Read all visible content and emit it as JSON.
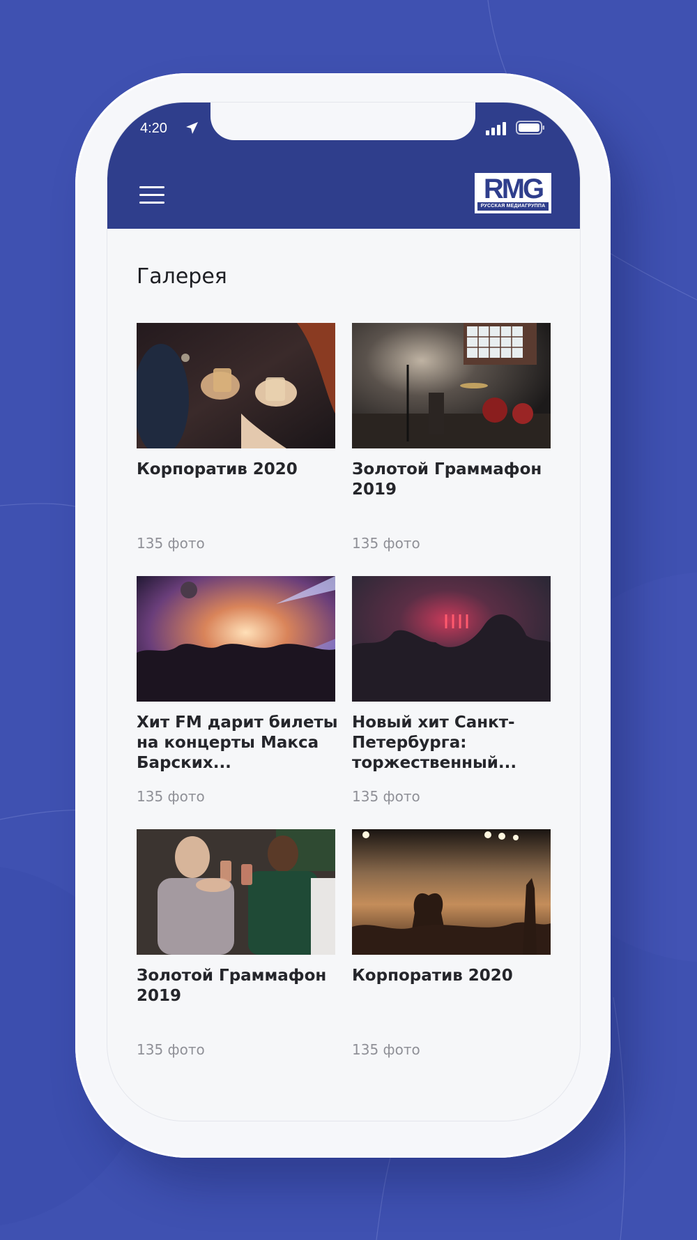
{
  "status_bar": {
    "time": "4:20"
  },
  "header": {
    "logo_letters": "RMG",
    "logo_caption": "РУССКАЯ МЕДИАГРУППА"
  },
  "page": {
    "title": "Галерея"
  },
  "gallery": [
    {
      "title": "Корпоратив 2020",
      "count": "135 фото"
    },
    {
      "title": "Золотой Граммафон 2019",
      "count": "135 фото"
    },
    {
      "title": "Хит FM дарит билеты на концерты Макса Барских...",
      "count": "135 фото"
    },
    {
      "title": "Новый хит Санкт-Петербурга: торжественный...",
      "count": "135 фото"
    },
    {
      "title": "Золотой Граммафон 2019",
      "count": "135 фото"
    },
    {
      "title": "Корпоратив 2020",
      "count": "135 фото"
    }
  ],
  "colors": {
    "background": "#3f51b1",
    "app_bar": "#2f3e8c",
    "screen": "#f6f7f9",
    "title_text": "#25262b",
    "muted_text": "#8f9097"
  }
}
